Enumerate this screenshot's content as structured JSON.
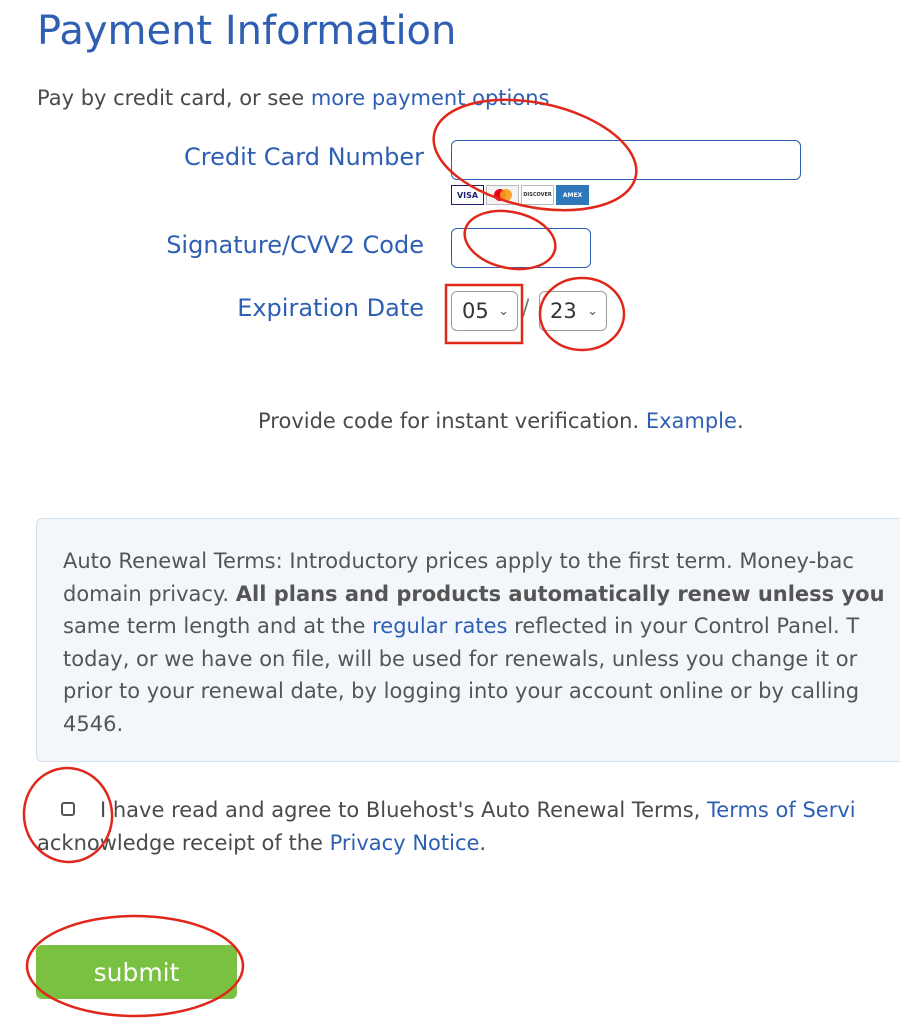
{
  "page": {
    "title": "Payment Information",
    "intro_text": "Pay by credit card, or see ",
    "intro_link": "more payment options"
  },
  "form": {
    "card_number_label": "Credit Card Number",
    "card_number_value": "",
    "card_logos": [
      {
        "name": "visa-logo",
        "text": "VISA",
        "color": "#1a1f71"
      },
      {
        "name": "mastercard-logo",
        "text": "",
        "color": "#f79e1b"
      },
      {
        "name": "discover-logo",
        "text": "DISCOVER",
        "color": "#f58220"
      },
      {
        "name": "amex-logo",
        "text": "AMEX",
        "color": "#2e77bb"
      }
    ],
    "cvv_label": "Signature/CVV2 Code",
    "cvv_value": "",
    "expiration_label": "Expiration Date",
    "exp_month": "05",
    "exp_separator": "/",
    "exp_year": "23",
    "help_text": "Provide code for instant verification. ",
    "help_link": "Example",
    "help_suffix": "."
  },
  "terms": {
    "line1": "Auto Renewal Terms: Introductory prices apply to the first term. Money-bac",
    "line2_pre": "domain privacy. ",
    "line2_bold": "All plans and products automatically renew unless you",
    "line3_pre": "same term length and at the ",
    "line3_link": "regular rates",
    "line3_post": " reflected in your Control Panel. T",
    "line4": "today, or we have on file, will be used for renewals, unless you change it or",
    "line5": "prior to your renewal date, by logging into your account online or by calling",
    "line6": "4546."
  },
  "agreement": {
    "text1": "I have read and agree to Bluehost's Auto Renewal Terms, ",
    "link1": "Terms of Servi",
    "text2": "acknowledge receipt of the ",
    "link2": "Privacy Notice",
    "text2_suffix": ".",
    "checked": false
  },
  "submit_label": "submit",
  "colors": {
    "brand_blue": "#2e5fb3",
    "submit_green": "#7ac142",
    "annotation_red": "#e0281a"
  }
}
